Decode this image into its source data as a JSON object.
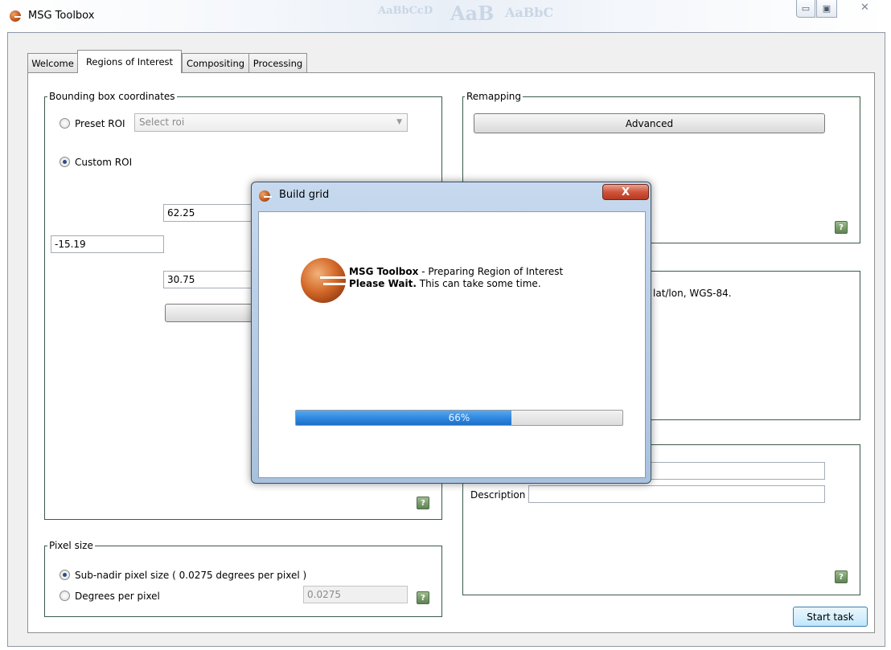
{
  "window": {
    "title": "MSG Toolbox"
  },
  "tabs": [
    {
      "label": "Welcome",
      "active": false
    },
    {
      "label": "Regions of Interest",
      "active": true
    },
    {
      "label": "Compositing",
      "active": false
    },
    {
      "label": "Processing",
      "active": false
    }
  ],
  "bounding_box": {
    "title": "Bounding box coordinates",
    "preset_label": "Preset ROI",
    "preset_selected": false,
    "select_placeholder": "Select roi",
    "custom_label": "Custom ROI",
    "custom_selected": true,
    "north": "62.25",
    "west": "-15.19",
    "south": "30.75"
  },
  "pixel_size": {
    "title": "Pixel size",
    "subnadir_label": "Sub-nadir pixel size ( 0.0275 degrees per pixel )",
    "subnadir_selected": true,
    "dpp_label": "Degrees per pixel",
    "dpp_selected": false,
    "dpp_value": "0.0275"
  },
  "remapping": {
    "title": "Remapping",
    "advanced_label": "Advanced"
  },
  "projection": {
    "text": "lat/lon, WGS-84."
  },
  "save_roi": {
    "description_label": "Description",
    "name_value": "",
    "description_value": ""
  },
  "help_label": "?",
  "start_task_label": "Start task",
  "dialog": {
    "title": "Build grid",
    "close_glyph": "X",
    "app_name": "MSG Toolbox",
    "message_rest": " - Preparing Region of Interest",
    "wait_bold": "Please Wait.",
    "wait_rest": " This can take some time.",
    "progress": 66,
    "progress_text": "66%"
  },
  "colors": {
    "progress_fill": "#2f86de",
    "group_border": "#3b5b4a",
    "accent": "#d46a2a"
  }
}
